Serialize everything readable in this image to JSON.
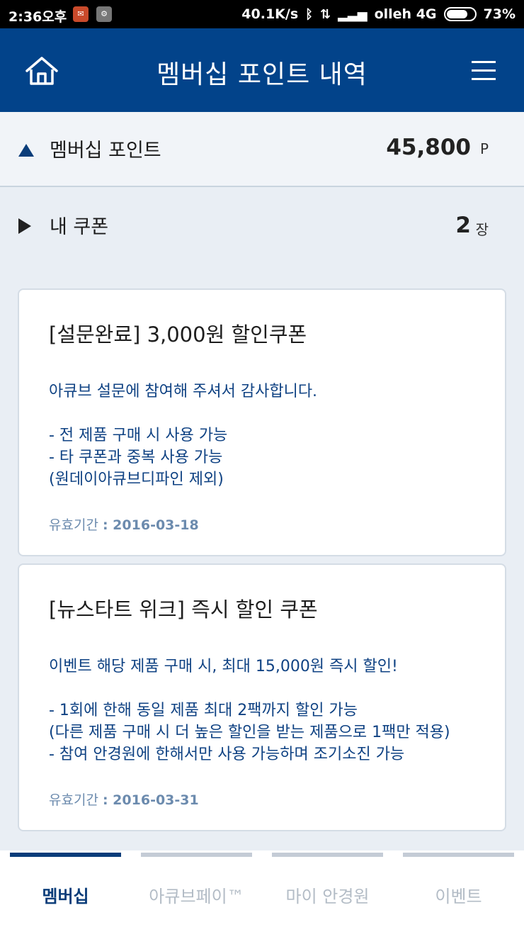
{
  "status_bar": {
    "time": "2:36오후",
    "speed": "40.1K/s",
    "carrier": "olleh 4G",
    "battery": "73%"
  },
  "header": {
    "title": "멤버십 포인트 내역"
  },
  "points": {
    "label": "멤버십 포인트",
    "value": "45,800",
    "unit": "P"
  },
  "coupons": {
    "label": "내 쿠폰",
    "value": "2",
    "unit": "장"
  },
  "cards": [
    {
      "title": "[설문완료] 3,000원 할인쿠폰",
      "description": "아큐브 설문에 참여해 주셔서 감사합니다.\n\n- 전 제품 구매 시 사용 가능\n- 타 쿠폰과 중복 사용 가능\n(원데이아큐브디파인 제외)",
      "expiry_label": "유효기간",
      "expiry_date": ": 2016-03-18"
    },
    {
      "title": "[뉴스타트 위크] 즉시 할인 쿠폰",
      "description": "이벤트 해당 제품 구매 시, 최대 15,000원 즉시 할인!\n\n- 1회에 한해 동일 제품 최대 2팩까지 할인 가능\n(다른 제품 구매 시 더 높은 할인을 받는 제품으로 1팩만 적용)\n- 참여 안경원에 한해서만 사용 가능하며 조기소진 가능",
      "expiry_label": "유효기간",
      "expiry_date": ": 2016-03-31"
    }
  ],
  "tabs": [
    {
      "label": "멤버십"
    },
    {
      "label": "아큐브페이™"
    },
    {
      "label": "마이 안경원"
    },
    {
      "label": "이벤트"
    }
  ],
  "colors": {
    "header_bg": "#02438a",
    "accent": "#0b3d7a",
    "desc_text": "#0f4283"
  }
}
